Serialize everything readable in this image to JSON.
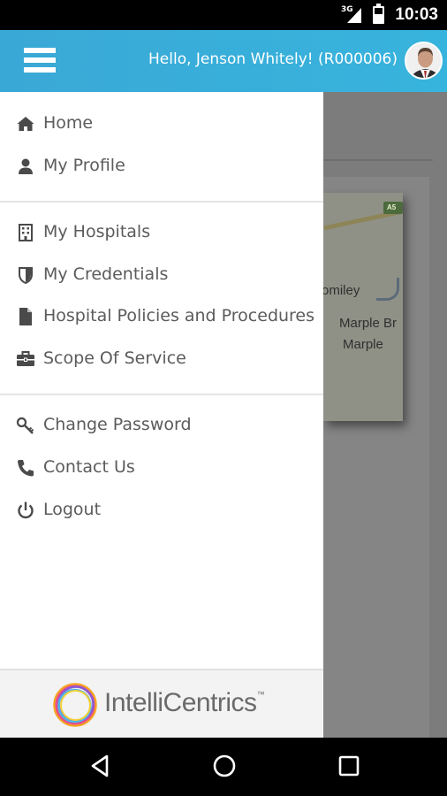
{
  "status_bar": {
    "network": "3G",
    "time": "10:03"
  },
  "header": {
    "greeting": "Hello, Jenson Whitely! (R000006)"
  },
  "menu": {
    "section1": [
      {
        "label": "Home",
        "icon": "home-icon"
      },
      {
        "label": "My Profile",
        "icon": "user-icon"
      }
    ],
    "section2": [
      {
        "label": "My Hospitals",
        "icon": "hospital-icon"
      },
      {
        "label": "My Credentials",
        "icon": "shield-icon"
      },
      {
        "label": "Hospital Policies and Procedures",
        "icon": "document-icon"
      },
      {
        "label": "Scope Of Service",
        "icon": "briefcase-icon"
      }
    ],
    "section3": [
      {
        "label": "Change Password",
        "icon": "key-icon"
      },
      {
        "label": "Contact Us",
        "icon": "phone-icon"
      },
      {
        "label": "Logout",
        "icon": "power-icon"
      }
    ]
  },
  "footer": {
    "logo_text": "IntelliCentrics",
    "trademark": "™"
  },
  "map": {
    "road_badge": "A5",
    "places": [
      "omiley",
      "Marple Br",
      "Marple"
    ]
  },
  "colors": {
    "app_bar": "#37b4dd",
    "menu_text": "#5b5b5b",
    "icon": "#4a4a4a"
  }
}
